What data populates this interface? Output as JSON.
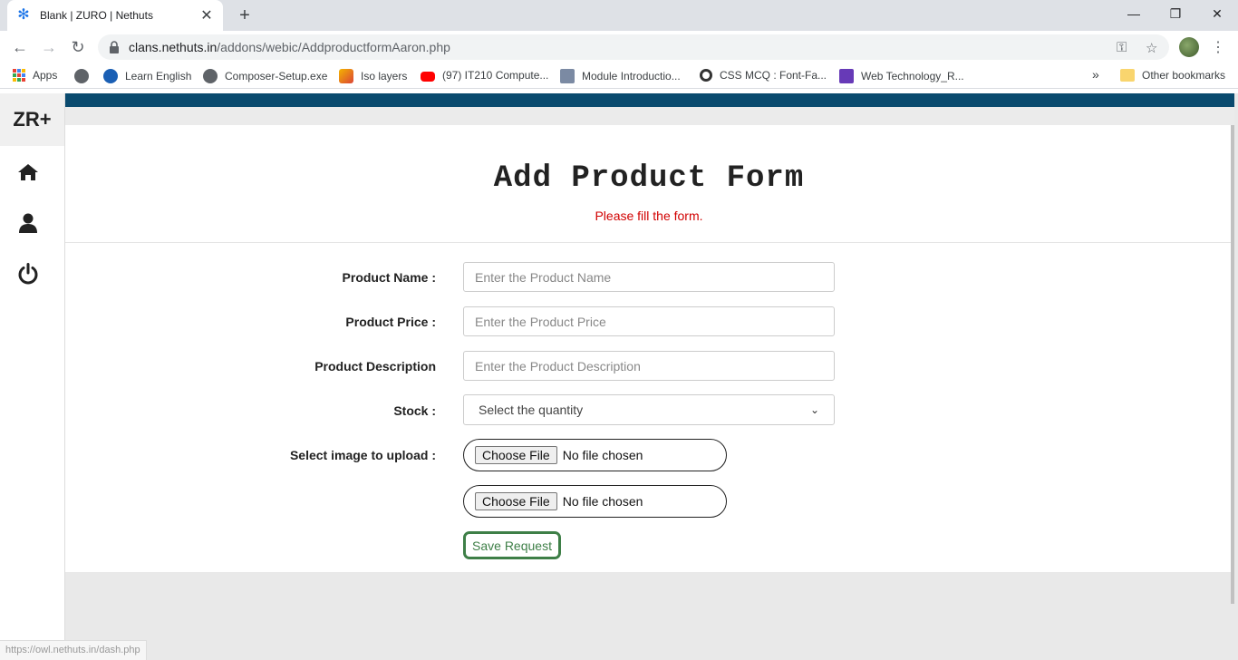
{
  "browser": {
    "tab_title": "Blank | ZURO | Nethuts",
    "url_host": "clans.nethuts.in",
    "url_path": "/addons/webic/AddproductformAaron.php",
    "bookmarks": [
      {
        "label": "Apps",
        "icon": "apps-grid-icon"
      },
      {
        "label": "",
        "icon": "globe-icon"
      },
      {
        "label": "Learn English",
        "icon": "learn-english-icon"
      },
      {
        "label": "Composer-Setup.exe",
        "icon": "globe-icon"
      },
      {
        "label": "Iso layers",
        "icon": "iso-layers-icon"
      },
      {
        "label": "(97) IT210 Compute...",
        "icon": "youtube-icon"
      },
      {
        "label": "Module Introductio...",
        "icon": "module-icon"
      },
      {
        "label": "CSS MCQ : Font-Fa...",
        "icon": "circle-icon"
      },
      {
        "label": "Web Technology_R...",
        "icon": "forms-icon"
      }
    ],
    "other_bookmarks": "Other bookmarks",
    "overflow": "»",
    "status_url": "https://owl.nethuts.in/dash.php"
  },
  "sidebar": {
    "logo": "ZR+",
    "items": [
      "home-icon",
      "user-icon",
      "power-icon"
    ]
  },
  "form": {
    "title": "Add Product Form",
    "subtitle": "Please fill the form.",
    "fields": {
      "name_label": "Product Name :",
      "name_placeholder": "Enter the Product Name",
      "price_label": "Product Price :",
      "price_placeholder": "Enter the Product Price",
      "desc_label": "Product Description",
      "desc_placeholder": "Enter the Product Description",
      "stock_label": "Stock :",
      "stock_selected": "Select the quantity",
      "image_label": "Select image to upload :",
      "choose_file": "Choose File",
      "no_file": "No file chosen"
    },
    "save_label": "Save Request"
  },
  "colors": {
    "header_bar": "#0a4a6e",
    "subtitle": "#d10000",
    "save_button": "#3e7f47"
  }
}
